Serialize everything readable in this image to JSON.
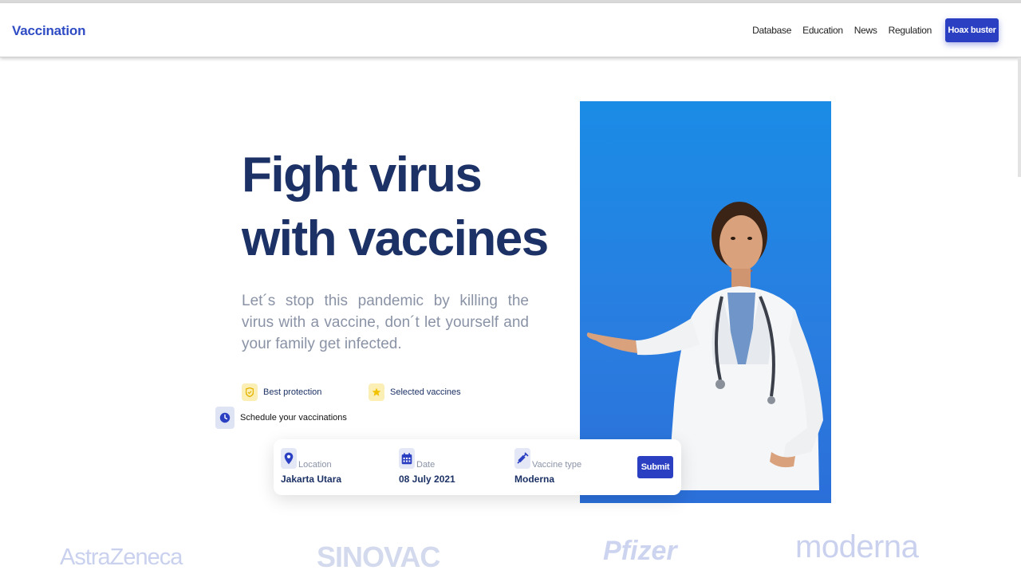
{
  "header": {
    "brand": "Vaccination",
    "nav": [
      "Database",
      "Education",
      "News",
      "Regulation"
    ],
    "cta": "Hoax buster"
  },
  "hero": {
    "title_line1": "Fight virus",
    "title_line2": "with vaccines",
    "subtitle": "Let´s stop this pandemic by killing the virus with a vaccine, don´t let yourself and your family get infected."
  },
  "features": [
    {
      "label": "Best protection",
      "icon": "shield-icon"
    },
    {
      "label": "Selected vaccines",
      "icon": "star-icon"
    },
    {
      "label": "Schedule your vaccinations",
      "icon": "clock-icon"
    }
  ],
  "booking": {
    "location_label": "Location",
    "location_value": "Jakarta Utara",
    "date_label": "Date",
    "date_value": "08 July 2021",
    "vaccine_label": "Vaccine type",
    "vaccine_value": "Moderna",
    "submit": "Submit"
  },
  "partners": [
    "AstraZeneca",
    "SINOVAC",
    "Pfizer",
    "moderna"
  ],
  "colors": {
    "accent": "#2b3fc2",
    "heading": "#1c3165",
    "hero_bg": "#1a8ce6"
  }
}
